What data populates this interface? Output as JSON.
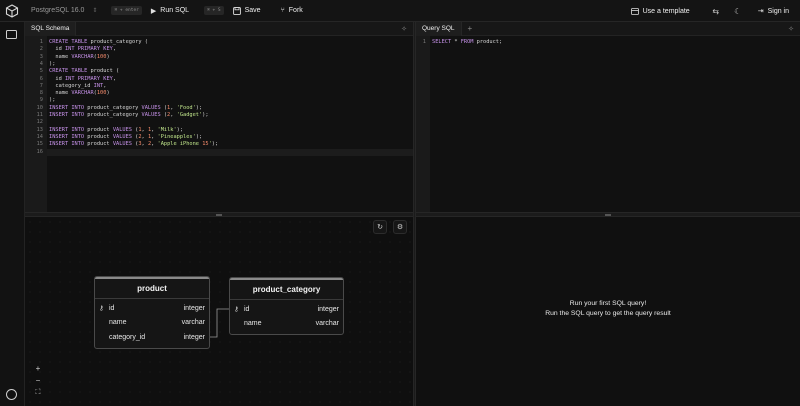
{
  "header": {
    "db_label": "PostgreSQL 16.0",
    "run_shortcut": "⌘ + enter",
    "run_label": "Run SQL",
    "save_shortcut": "⌘ + S",
    "save_label": "Save",
    "fork_label": "Fork",
    "template_label": "Use a template",
    "signin_label": "Sign in"
  },
  "schema_pane": {
    "tab_label": "SQL Schema",
    "lines": [
      "1",
      "2",
      "3",
      "4",
      "5",
      "6",
      "7",
      "8",
      "9",
      "10",
      "11",
      "12",
      "13",
      "14",
      "15",
      "16"
    ],
    "code": [
      "CREATE TABLE product_category (",
      "  id INT PRIMARY KEY,",
      "  name VARCHAR(100)",
      ");",
      "CREATE TABLE product (",
      "  id INT PRIMARY KEY,",
      "  category_id INT,",
      "  name VARCHAR(100)",
      ");",
      "INSERT INTO product_category VALUES (1, 'Food');",
      "INSERT INTO product_category VALUES (2, 'Gadget');",
      "",
      "INSERT INTO product VALUES (1, 1, 'Milk');",
      "INSERT INTO product VALUES (2, 1, 'Pineapples');",
      "INSERT INTO product VALUES (3, 2, 'Apple iPhone 15');",
      ""
    ]
  },
  "query_pane": {
    "tab_label": "Query SQL",
    "lines": [
      "1"
    ],
    "code": [
      "SELECT * FROM product;"
    ]
  },
  "diagram": {
    "tables": [
      {
        "name": "product",
        "columns": [
          {
            "name": "id",
            "type": "integer",
            "key": true
          },
          {
            "name": "name",
            "type": "varchar",
            "key": false
          },
          {
            "name": "category_id",
            "type": "integer",
            "key": false
          }
        ]
      },
      {
        "name": "product_category",
        "columns": [
          {
            "name": "id",
            "type": "integer",
            "key": true
          },
          {
            "name": "name",
            "type": "varchar",
            "key": false
          }
        ]
      }
    ],
    "zoom_in": "+",
    "zoom_out": "−",
    "fit": "⛶"
  },
  "results": {
    "title": "Run your first SQL query!",
    "subtitle": "Run the SQL query to get the query result"
  }
}
